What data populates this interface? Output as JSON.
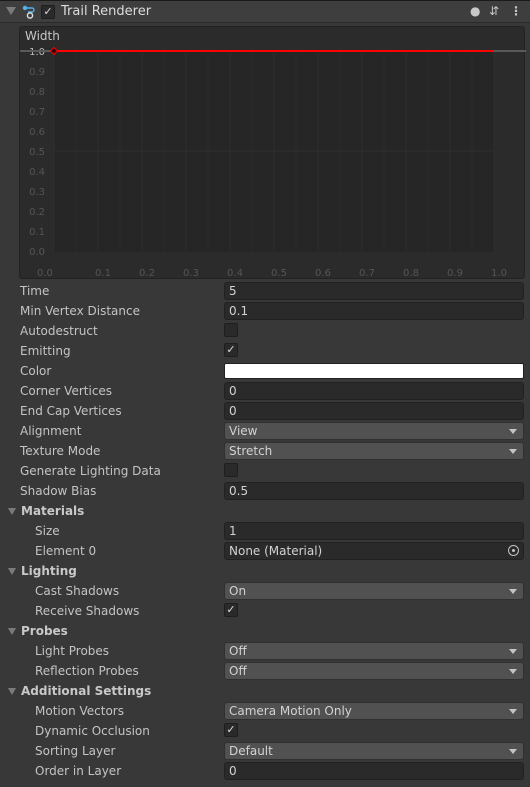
{
  "component": {
    "title": "Trail Renderer",
    "enabled": true,
    "icons": [
      "trail-renderer-icon",
      "help-icon",
      "presets-icon",
      "more-menu-icon"
    ]
  },
  "chart_data": {
    "type": "line",
    "title": "Width",
    "x": [
      0.0,
      1.0
    ],
    "y": [
      1.0,
      1.0
    ],
    "xlim": [
      0.0,
      1.0
    ],
    "ylim": [
      0.0,
      1.0
    ],
    "xticks": [
      "0.0",
      "0.1",
      "0.2",
      "0.3",
      "0.4",
      "0.5",
      "0.6",
      "0.7",
      "0.8",
      "0.9",
      "1.0"
    ],
    "yticks": [
      "1.0",
      "0.9",
      "0.8",
      "0.7",
      "0.6",
      "0.5",
      "0.4",
      "0.3",
      "0.2",
      "0.1",
      "0.0"
    ],
    "line_color": "#ff0000",
    "grid": true
  },
  "rows": [
    {
      "label": "Time",
      "type": "field",
      "value": "5"
    },
    {
      "label": "Min Vertex Distance",
      "type": "field",
      "value": "0.1"
    },
    {
      "label": "Autodestruct",
      "type": "toggle",
      "checked": false
    },
    {
      "label": "Emitting",
      "type": "toggle",
      "checked": true
    },
    {
      "label": "Color",
      "type": "color",
      "value": "#ffffff"
    },
    {
      "label": "Corner Vertices",
      "type": "field",
      "value": "0"
    },
    {
      "label": "End Cap Vertices",
      "type": "field",
      "value": "0"
    },
    {
      "label": "Alignment",
      "type": "dropdown",
      "value": "View"
    },
    {
      "label": "Texture Mode",
      "type": "dropdown",
      "value": "Stretch"
    },
    {
      "label": "Generate Lighting Data",
      "type": "toggle",
      "checked": false
    },
    {
      "label": "Shadow Bias",
      "type": "field",
      "value": "0.5"
    },
    {
      "label": "Materials",
      "type": "header"
    },
    {
      "label": "Size",
      "type": "field",
      "value": "1",
      "indent": true
    },
    {
      "label": "Element 0",
      "type": "object",
      "value": "None (Material)",
      "indent": true
    },
    {
      "label": "Lighting",
      "type": "header"
    },
    {
      "label": "Cast Shadows",
      "type": "dropdown",
      "value": "On",
      "indent": true
    },
    {
      "label": "Receive Shadows",
      "type": "toggle",
      "checked": true,
      "indent": true
    },
    {
      "label": "Probes",
      "type": "header"
    },
    {
      "label": "Light Probes",
      "type": "dropdown",
      "value": "Off",
      "indent": true
    },
    {
      "label": "Reflection Probes",
      "type": "dropdown",
      "value": "Off",
      "indent": true
    },
    {
      "label": "Additional Settings",
      "type": "header"
    },
    {
      "label": "Motion Vectors",
      "type": "dropdown",
      "value": "Camera Motion Only",
      "indent": true
    },
    {
      "label": "Dynamic Occlusion",
      "type": "toggle",
      "checked": true,
      "indent": true
    },
    {
      "label": "Sorting Layer",
      "type": "dropdown",
      "value": "Default",
      "indent": true
    },
    {
      "label": "Order in Layer",
      "type": "field",
      "value": "0",
      "indent": true
    }
  ],
  "check_glyph": "✓"
}
